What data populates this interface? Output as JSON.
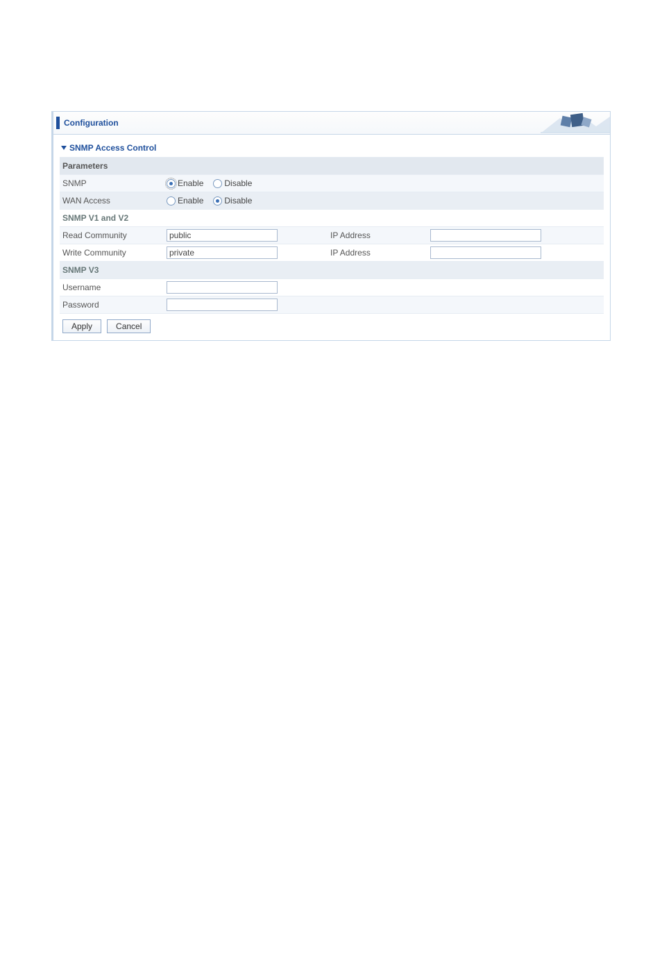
{
  "header": {
    "title": "Configuration"
  },
  "section": {
    "title": "SNMP Access Control"
  },
  "labels": {
    "parameters": "Parameters",
    "snmp": "SNMP",
    "wan_access": "WAN Access",
    "snmp_v1v2": "SNMP V1 and V2",
    "read_community": "Read Community",
    "write_community": "Write Community",
    "ip_address": "IP Address",
    "snmp_v3": "SNMP V3",
    "username": "Username",
    "password": "Password",
    "enable": "Enable",
    "disable": "Disable"
  },
  "values": {
    "snmp_enabled": true,
    "wan_access_enabled": false,
    "read_community": "public",
    "write_community": "private",
    "read_ip": "",
    "write_ip": "",
    "username": "",
    "password": ""
  },
  "buttons": {
    "apply": "Apply",
    "cancel": "Cancel"
  }
}
